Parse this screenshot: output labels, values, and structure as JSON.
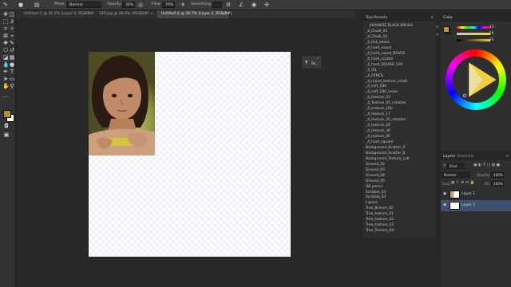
{
  "options_bar": {
    "mode_label": "Mode:",
    "mode_value": "Normal",
    "opacity_label": "Opacity:",
    "opacity_value": "30%",
    "flow_label": "Flow:",
    "flow_value": "79%",
    "smoothing_label": "Smoothing:"
  },
  "tabs": [
    {
      "label": "Untitled-1 @ 40.3% (Layer 2, RGB/8#)",
      "close": "×",
      "active": false
    },
    {
      "label": "345.jpg @ 48.8% (RGB/8#)",
      "close": "×",
      "active": false
    },
    {
      "label": "Untitled-2 @ 36.7% (Layer 2, RGB/8#)",
      "close": "×",
      "active": true
    }
  ],
  "float_panel": {
    "label": "Pa..."
  },
  "tool_presets": {
    "title": "Tool Presets",
    "items": [
      "JAPANESE BLACK BRUSH",
      "_4_Chalk_01",
      "_4_Chalk_02",
      "_4_flat_rotate",
      "_4_hard_round",
      "_4_hard_round_BEADS",
      "_4_hard_scatter",
      "_4_hard_SQUISH 138",
      "_4_OIL",
      "_4_PENCIL",
      "_4_round_texture_small",
      "_4_soft_180",
      "_4_soft_180_noise",
      "_4_texture_02",
      "_4_Texture_05_rotation",
      "_4_texture_15b",
      "_4_texture_17",
      "_4_texture_20_rotation",
      "_4_texture_24",
      "_4_texture_34",
      "_4_texture_40",
      "_4_hard_square",
      "Background_Scatter_A",
      "Background_Scatter_B",
      "Background_Texture_Lub",
      "Ground_02",
      "Ground_03",
      "Ground_04",
      "Ground_05",
      "HB pencil",
      "Scribble_01",
      "Scribble_02",
      "t grass",
      "Tree_Branch_02",
      "Tree_texture_01",
      "Tree_texture_02",
      "Tree_texture_03",
      "Tree_Texture_04"
    ]
  },
  "color_panel": {
    "title": "Color",
    "h_value": "43",
    "s_value": "79",
    "b_value": "75",
    "swatch_fg": "#b8932c",
    "swatch_bg": "#ffffff"
  },
  "layers_panel": {
    "tab_layers": "Layers",
    "tab_channels": "Channels",
    "kind_label": "Kind",
    "blend_mode": "Normal",
    "opacity_label": "Opacity:",
    "opacity_value": "100%",
    "lock_label": "Lock:",
    "fill_label": "Fill:",
    "fill_value": "100%",
    "layers": [
      {
        "name": "Layer 1",
        "selected": false
      },
      {
        "name": "Layer 2",
        "selected": true
      }
    ]
  },
  "colors": {
    "selection": "#405070",
    "accent_gold": "#f2cf3c"
  }
}
